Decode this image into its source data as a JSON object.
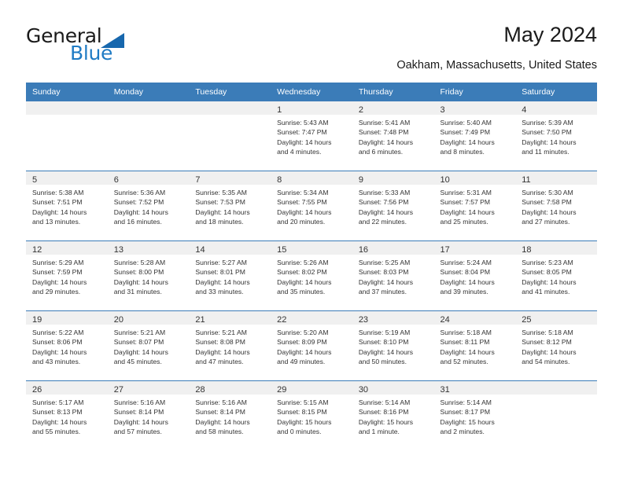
{
  "brand": {
    "name_part1": "General",
    "name_part2": "Blue",
    "accent_color": "#1f7bc4",
    "triangle_color": "#1767ad"
  },
  "header": {
    "title": "May 2024",
    "subtitle": "Oakham, Massachusetts, United States"
  },
  "calendar": {
    "header_bg": "#3b7cb8",
    "daynum_bg": "#f0f0f0",
    "weekday_headers": [
      "Sunday",
      "Monday",
      "Tuesday",
      "Wednesday",
      "Thursday",
      "Friday",
      "Saturday"
    ],
    "weeks": [
      [
        {
          "day": "",
          "sunrise": "",
          "sunset": "",
          "daylight1": "",
          "daylight2": ""
        },
        {
          "day": "",
          "sunrise": "",
          "sunset": "",
          "daylight1": "",
          "daylight2": ""
        },
        {
          "day": "",
          "sunrise": "",
          "sunset": "",
          "daylight1": "",
          "daylight2": ""
        },
        {
          "day": "1",
          "sunrise": "Sunrise: 5:43 AM",
          "sunset": "Sunset: 7:47 PM",
          "daylight1": "Daylight: 14 hours",
          "daylight2": "and 4 minutes."
        },
        {
          "day": "2",
          "sunrise": "Sunrise: 5:41 AM",
          "sunset": "Sunset: 7:48 PM",
          "daylight1": "Daylight: 14 hours",
          "daylight2": "and 6 minutes."
        },
        {
          "day": "3",
          "sunrise": "Sunrise: 5:40 AM",
          "sunset": "Sunset: 7:49 PM",
          "daylight1": "Daylight: 14 hours",
          "daylight2": "and 8 minutes."
        },
        {
          "day": "4",
          "sunrise": "Sunrise: 5:39 AM",
          "sunset": "Sunset: 7:50 PM",
          "daylight1": "Daylight: 14 hours",
          "daylight2": "and 11 minutes."
        }
      ],
      [
        {
          "day": "5",
          "sunrise": "Sunrise: 5:38 AM",
          "sunset": "Sunset: 7:51 PM",
          "daylight1": "Daylight: 14 hours",
          "daylight2": "and 13 minutes."
        },
        {
          "day": "6",
          "sunrise": "Sunrise: 5:36 AM",
          "sunset": "Sunset: 7:52 PM",
          "daylight1": "Daylight: 14 hours",
          "daylight2": "and 16 minutes."
        },
        {
          "day": "7",
          "sunrise": "Sunrise: 5:35 AM",
          "sunset": "Sunset: 7:53 PM",
          "daylight1": "Daylight: 14 hours",
          "daylight2": "and 18 minutes."
        },
        {
          "day": "8",
          "sunrise": "Sunrise: 5:34 AM",
          "sunset": "Sunset: 7:55 PM",
          "daylight1": "Daylight: 14 hours",
          "daylight2": "and 20 minutes."
        },
        {
          "day": "9",
          "sunrise": "Sunrise: 5:33 AM",
          "sunset": "Sunset: 7:56 PM",
          "daylight1": "Daylight: 14 hours",
          "daylight2": "and 22 minutes."
        },
        {
          "day": "10",
          "sunrise": "Sunrise: 5:31 AM",
          "sunset": "Sunset: 7:57 PM",
          "daylight1": "Daylight: 14 hours",
          "daylight2": "and 25 minutes."
        },
        {
          "day": "11",
          "sunrise": "Sunrise: 5:30 AM",
          "sunset": "Sunset: 7:58 PM",
          "daylight1": "Daylight: 14 hours",
          "daylight2": "and 27 minutes."
        }
      ],
      [
        {
          "day": "12",
          "sunrise": "Sunrise: 5:29 AM",
          "sunset": "Sunset: 7:59 PM",
          "daylight1": "Daylight: 14 hours",
          "daylight2": "and 29 minutes."
        },
        {
          "day": "13",
          "sunrise": "Sunrise: 5:28 AM",
          "sunset": "Sunset: 8:00 PM",
          "daylight1": "Daylight: 14 hours",
          "daylight2": "and 31 minutes."
        },
        {
          "day": "14",
          "sunrise": "Sunrise: 5:27 AM",
          "sunset": "Sunset: 8:01 PM",
          "daylight1": "Daylight: 14 hours",
          "daylight2": "and 33 minutes."
        },
        {
          "day": "15",
          "sunrise": "Sunrise: 5:26 AM",
          "sunset": "Sunset: 8:02 PM",
          "daylight1": "Daylight: 14 hours",
          "daylight2": "and 35 minutes."
        },
        {
          "day": "16",
          "sunrise": "Sunrise: 5:25 AM",
          "sunset": "Sunset: 8:03 PM",
          "daylight1": "Daylight: 14 hours",
          "daylight2": "and 37 minutes."
        },
        {
          "day": "17",
          "sunrise": "Sunrise: 5:24 AM",
          "sunset": "Sunset: 8:04 PM",
          "daylight1": "Daylight: 14 hours",
          "daylight2": "and 39 minutes."
        },
        {
          "day": "18",
          "sunrise": "Sunrise: 5:23 AM",
          "sunset": "Sunset: 8:05 PM",
          "daylight1": "Daylight: 14 hours",
          "daylight2": "and 41 minutes."
        }
      ],
      [
        {
          "day": "19",
          "sunrise": "Sunrise: 5:22 AM",
          "sunset": "Sunset: 8:06 PM",
          "daylight1": "Daylight: 14 hours",
          "daylight2": "and 43 minutes."
        },
        {
          "day": "20",
          "sunrise": "Sunrise: 5:21 AM",
          "sunset": "Sunset: 8:07 PM",
          "daylight1": "Daylight: 14 hours",
          "daylight2": "and 45 minutes."
        },
        {
          "day": "21",
          "sunrise": "Sunrise: 5:21 AM",
          "sunset": "Sunset: 8:08 PM",
          "daylight1": "Daylight: 14 hours",
          "daylight2": "and 47 minutes."
        },
        {
          "day": "22",
          "sunrise": "Sunrise: 5:20 AM",
          "sunset": "Sunset: 8:09 PM",
          "daylight1": "Daylight: 14 hours",
          "daylight2": "and 49 minutes."
        },
        {
          "day": "23",
          "sunrise": "Sunrise: 5:19 AM",
          "sunset": "Sunset: 8:10 PM",
          "daylight1": "Daylight: 14 hours",
          "daylight2": "and 50 minutes."
        },
        {
          "day": "24",
          "sunrise": "Sunrise: 5:18 AM",
          "sunset": "Sunset: 8:11 PM",
          "daylight1": "Daylight: 14 hours",
          "daylight2": "and 52 minutes."
        },
        {
          "day": "25",
          "sunrise": "Sunrise: 5:18 AM",
          "sunset": "Sunset: 8:12 PM",
          "daylight1": "Daylight: 14 hours",
          "daylight2": "and 54 minutes."
        }
      ],
      [
        {
          "day": "26",
          "sunrise": "Sunrise: 5:17 AM",
          "sunset": "Sunset: 8:13 PM",
          "daylight1": "Daylight: 14 hours",
          "daylight2": "and 55 minutes."
        },
        {
          "day": "27",
          "sunrise": "Sunrise: 5:16 AM",
          "sunset": "Sunset: 8:14 PM",
          "daylight1": "Daylight: 14 hours",
          "daylight2": "and 57 minutes."
        },
        {
          "day": "28",
          "sunrise": "Sunrise: 5:16 AM",
          "sunset": "Sunset: 8:14 PM",
          "daylight1": "Daylight: 14 hours",
          "daylight2": "and 58 minutes."
        },
        {
          "day": "29",
          "sunrise": "Sunrise: 5:15 AM",
          "sunset": "Sunset: 8:15 PM",
          "daylight1": "Daylight: 15 hours",
          "daylight2": "and 0 minutes."
        },
        {
          "day": "30",
          "sunrise": "Sunrise: 5:14 AM",
          "sunset": "Sunset: 8:16 PM",
          "daylight1": "Daylight: 15 hours",
          "daylight2": "and 1 minute."
        },
        {
          "day": "31",
          "sunrise": "Sunrise: 5:14 AM",
          "sunset": "Sunset: 8:17 PM",
          "daylight1": "Daylight: 15 hours",
          "daylight2": "and 2 minutes."
        },
        {
          "day": "",
          "sunrise": "",
          "sunset": "",
          "daylight1": "",
          "daylight2": ""
        }
      ]
    ]
  }
}
